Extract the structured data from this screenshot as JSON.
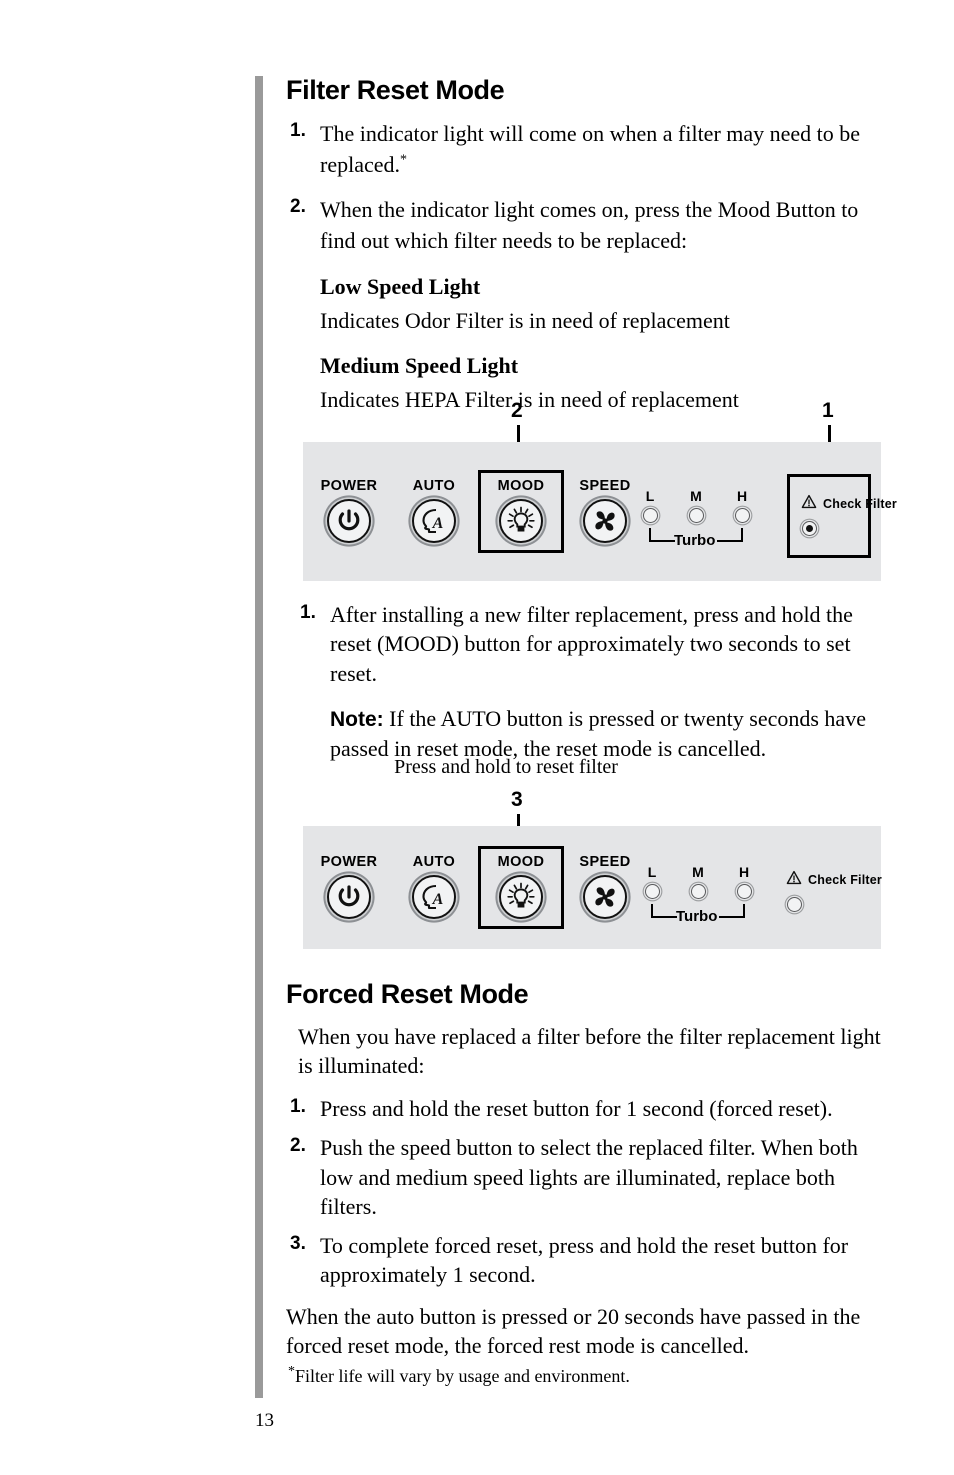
{
  "page": {
    "folio": "13",
    "footnote_marker": "*",
    "footnote": "Filter life will vary by usage and environment."
  },
  "section_filter_reset": {
    "title": "Filter Reset Mode",
    "steps": [
      {
        "num": "1.",
        "text": "The indicator light will come on when a filter may need to be replaced."
      },
      {
        "num": "2.",
        "text": "When the indicator light comes on, press the Mood Button to find out which filter needs to be replaced:"
      }
    ],
    "low_speed_heading": "Low Speed Light",
    "low_speed_text": "Indicates Odor Filter is in need of replacement",
    "medium_speed_heading": "Medium Speed Light",
    "medium_speed_text": "Indicates HEPA Filter is in need of replacement",
    "after_steps": [
      {
        "num": "1.",
        "text": "After installing a new filter replacement, press and hold the reset (MOOD) button for approximately two seconds to set reset."
      }
    ],
    "note_label": "Note:",
    "note_text": "If the AUTO button is pressed or twenty seconds have passed in reset mode, the reset mode is cancelled.",
    "figure2_caption": "Press and hold to reset filter"
  },
  "section_forced_reset": {
    "title": "Forced Reset Mode",
    "lead": "When you have replaced a filter before the filter replacement light is illuminated:",
    "steps": [
      {
        "num": "1.",
        "text": "Press and hold the reset button for 1 second (forced reset)."
      },
      {
        "num": "2.",
        "text": "Push the speed button to select the replaced filter. When both low and medium speed lights are illuminated, replace both filters."
      },
      {
        "num": "3.",
        "text": "To complete forced reset, press and hold the reset button for approximately 1 second."
      }
    ],
    "closing": "When the auto button is pressed or 20 seconds have passed in the forced reset mode, the forced rest mode is cancelled."
  },
  "panel_one": {
    "callouts": {
      "mood": "2",
      "check_filter": "1"
    },
    "buttons": [
      {
        "label": "POWER",
        "icon": "power-icon"
      },
      {
        "label": "AUTO",
        "icon": "auto-head-icon"
      },
      {
        "label": "MOOD",
        "icon": "mood-lightbulb-icon"
      },
      {
        "label": "SPEED",
        "icon": "speed-fan-icon"
      }
    ],
    "leds": [
      {
        "name": "L",
        "on": false
      },
      {
        "name": "M",
        "on": false
      },
      {
        "name": "H",
        "on": false
      }
    ],
    "turbo_label": "Turbo",
    "check_filter_label": "Check Filter",
    "check_filter_led_on": true,
    "highlight_mood": true,
    "highlight_check_filter": true
  },
  "panel_two": {
    "callouts": {
      "mood": "3"
    },
    "buttons": [
      {
        "label": "POWER",
        "icon": "power-icon"
      },
      {
        "label": "AUTO",
        "icon": "auto-head-icon"
      },
      {
        "label": "MOOD",
        "icon": "mood-lightbulb-icon"
      },
      {
        "label": "SPEED",
        "icon": "speed-fan-icon"
      }
    ],
    "leds": [
      {
        "name": "L",
        "on": false
      },
      {
        "name": "M",
        "on": false
      },
      {
        "name": "H",
        "on": false
      }
    ],
    "turbo_label": "Turbo",
    "check_filter_label": "Check Filter",
    "check_filter_led_on": false,
    "highlight_mood": true,
    "highlight_check_filter": false
  },
  "colors": {
    "panel_background": "#e4e5e7",
    "side_rule": "#9a9a9a",
    "ink": "#000000"
  }
}
